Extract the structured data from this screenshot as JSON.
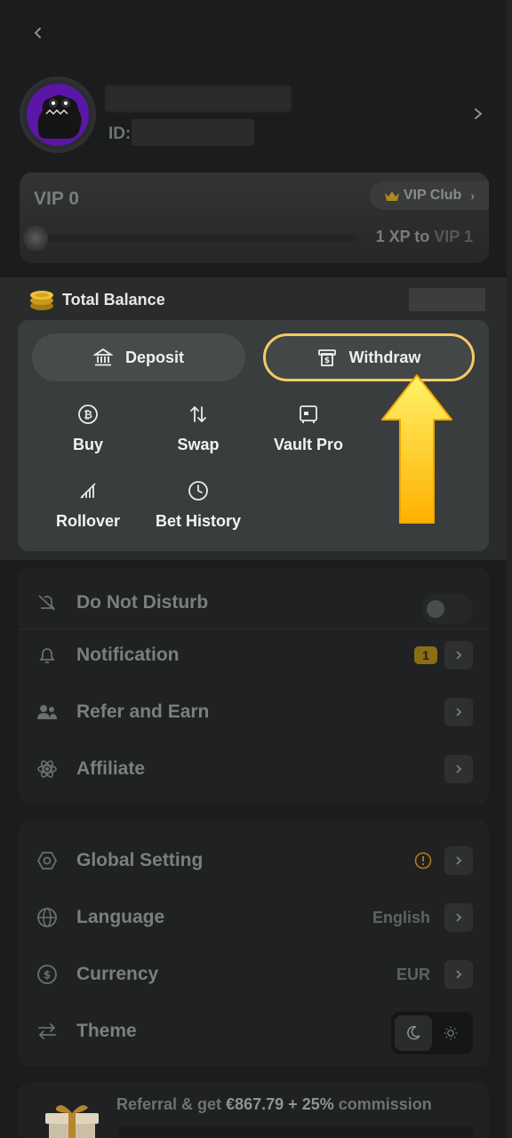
{
  "header": {
    "back_label": ""
  },
  "profile": {
    "id_label": "ID:"
  },
  "vip": {
    "level": "VIP 0",
    "club_label": "VIP Club",
    "progress_xp_text": "1 XP to",
    "progress_target": "VIP 1",
    "progress_fraction": 0
  },
  "balance": {
    "title": "Total Balance",
    "deposit_label": "Deposit",
    "withdraw_label": "Withdraw",
    "actions": [
      {
        "label": "Buy",
        "icon": "bitcoin-icon"
      },
      {
        "label": "Swap",
        "icon": "swap-icon"
      },
      {
        "label": "Vault Pro",
        "icon": "vault-icon"
      },
      {
        "label": "Rollover",
        "icon": "rollover-icon"
      },
      {
        "label": "Bet History",
        "icon": "clock-icon"
      }
    ]
  },
  "menu1": {
    "dnd_label": "Do Not Disturb",
    "dnd_on": false,
    "notification_label": "Notification",
    "notification_count": "1",
    "refer_label": "Refer and Earn",
    "affiliate_label": "Affiliate"
  },
  "menu2": {
    "global_label": "Global Setting",
    "language_label": "Language",
    "language_value": "English",
    "currency_label": "Currency",
    "currency_value": "EUR",
    "theme_label": "Theme",
    "theme_selected": "dark"
  },
  "referral": {
    "prefix": "Referral & get",
    "amount": "€867.79",
    "plus": "+",
    "percent": "25%",
    "suffix": "commission"
  },
  "colors": {
    "highlight_border": "#f6ca62",
    "arrow": "#ffc400",
    "badge": "#8a6e14"
  }
}
